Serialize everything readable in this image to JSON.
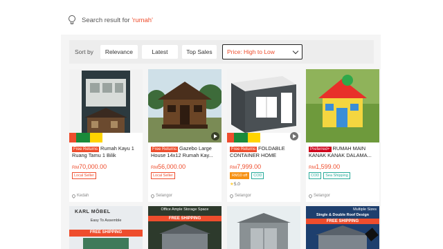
{
  "search": {
    "prefix": "Search result for ",
    "keyword": "'rumah'"
  },
  "sort": {
    "label": "Sort by",
    "options": [
      "Relevance",
      "Latest",
      "Top Sales"
    ],
    "price_select": "Price: High to Low"
  },
  "colors": {
    "accent": "#ee4d2d",
    "tag_green": "#26aa99",
    "star": "#ffce3d"
  },
  "products": [
    {
      "tag": "Free Returns",
      "title": "Rumah Kayu 1 Ruang Tamu 1 Bilik",
      "currency": "RM",
      "price": "70,000.00",
      "badges": [
        "Local Seller"
      ],
      "location": "Kedah"
    },
    {
      "tag": "Free Returns",
      "title": "Gazebo Large House 14x12 Rumah Kay...",
      "currency": "RM",
      "price": "56,000.00",
      "badges": [
        "Local Seller"
      ],
      "location": "Selangor"
    },
    {
      "tag": "Free Returns",
      "title": "FOLDABLE CONTAINER HOME",
      "currency": "RM",
      "price": "7,999.00",
      "badges": [
        "RM10 off",
        "COD"
      ],
      "rating": "5.0",
      "location": "Selangor"
    },
    {
      "tag": "Preferred+",
      "title": "RUMAH MAIN KANAK KANAK DALAMA...",
      "currency": "RM",
      "price": "1,599.00",
      "badges": [
        "COD",
        "Sea Shipping"
      ],
      "location": "Selangor"
    }
  ],
  "bottom_row": [
    {
      "brand": "KARL MÖBEL",
      "line1": "Easy To Assemble",
      "line2": "FREE SHIPPING"
    },
    {
      "line1": "Office Ample Storage Space",
      "line2": "FREE SHIPPING"
    },
    {
      "line1": "",
      "line2": ""
    },
    {
      "line1": "Multiple Sizes",
      "line2": "Single & Double Roof Design",
      "line3": "FREE SHIPPING"
    }
  ],
  "icons": [
    "lightbulb-icon",
    "chevron-down-icon",
    "play-icon",
    "location-pin-icon",
    "star-icon"
  ]
}
